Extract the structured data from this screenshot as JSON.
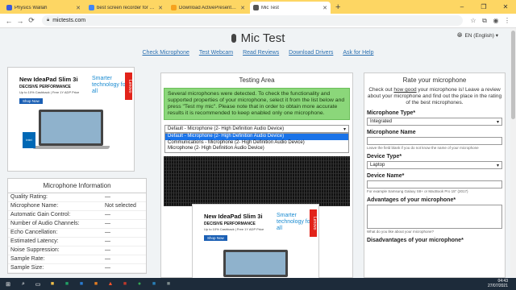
{
  "browser": {
    "tabs": [
      {
        "label": "Physics Wallah",
        "color": "#3b5bdb",
        "active": false
      },
      {
        "label": "best screen recorder for pc free",
        "color": "#4285f4",
        "active": false
      },
      {
        "label": "Download ActivePresenter - Vid",
        "color": "#f6a21e",
        "active": false
      },
      {
        "label": "Mic Test",
        "color": "#555555",
        "active": true
      }
    ],
    "new_tab": "+",
    "url": "mictests.com",
    "accent": "#fdd663"
  },
  "site": {
    "title": "Mic Test",
    "nav": [
      "Check Microphone",
      "Test Webcam",
      "Read Reviews",
      "Download Drivers",
      "Ask for Help"
    ],
    "language": "EN (English) ▾"
  },
  "ad": {
    "title": "New IdeaPad Slim 3i",
    "subtitle": "DECISIVE PERFORMANCE",
    "small": "Up to 10% Cashback | Free 1Y ADP Price",
    "button": "Shop Now",
    "tagline": "Smarter technology for all",
    "brand": "Lenovo",
    "chip": "intel CORE"
  },
  "mic_info": {
    "title": "Microphone Information",
    "rows": [
      {
        "k": "Quality Rating:",
        "v": "—"
      },
      {
        "k": "Microphone Name:",
        "v": "Not selected"
      },
      {
        "k": "Automatic Gain Control:",
        "v": "—"
      },
      {
        "k": "Number of Audio Channels:",
        "v": "—"
      },
      {
        "k": "Echo Cancellation:",
        "v": "—"
      },
      {
        "k": "Estimated Latency:",
        "v": "—"
      },
      {
        "k": "Noise Suppression:",
        "v": "—"
      },
      {
        "k": "Sample Rate:",
        "v": "—"
      },
      {
        "k": "Sample Size:",
        "v": "—"
      }
    ]
  },
  "testing": {
    "title": "Testing Area",
    "notice": "Several microphones were detected. To check the functionality and supported properties of your microphone, select it from the list below and press \"Test my mic\". Please note that in order to obtain more accurate results it is recommended to keep enabled only one microphone.",
    "selected": "Default - Microphone (2- High Definition Audio Device)",
    "options": [
      "Default - Microphone (2- High Definition Audio Device)",
      "Communications - Microphone (2- High Definition Audio Device)",
      "Microphone (2- High Definition Audio Device)"
    ]
  },
  "rate": {
    "title": "Rate your microphone",
    "intro_before": "Check out ",
    "intro_link": "how good",
    "intro_after": " your microphone is! Leave a review about your microphone and find out the place in the rating of the best microphones.",
    "mic_type_label": "Microphone Type*",
    "mic_type_value": "Integrated",
    "mic_name_label": "Microphone Name",
    "mic_name_help": "Leave the field blank if you do not know the name of your microphone",
    "device_type_label": "Device Type*",
    "device_type_value": "Laptop",
    "device_name_label": "Device Name*",
    "device_name_help": "For example Samsung Galaxy S8+ or MacBook Pro 15\" (2017)",
    "advantages_label": "Advantages of your microphone*",
    "advantages_help": "What do you like about your microphone?",
    "disadvantages_label": "Disadvantages of your microphone*"
  },
  "taskbar": {
    "time": "04:43",
    "date": "27/07/2021"
  }
}
